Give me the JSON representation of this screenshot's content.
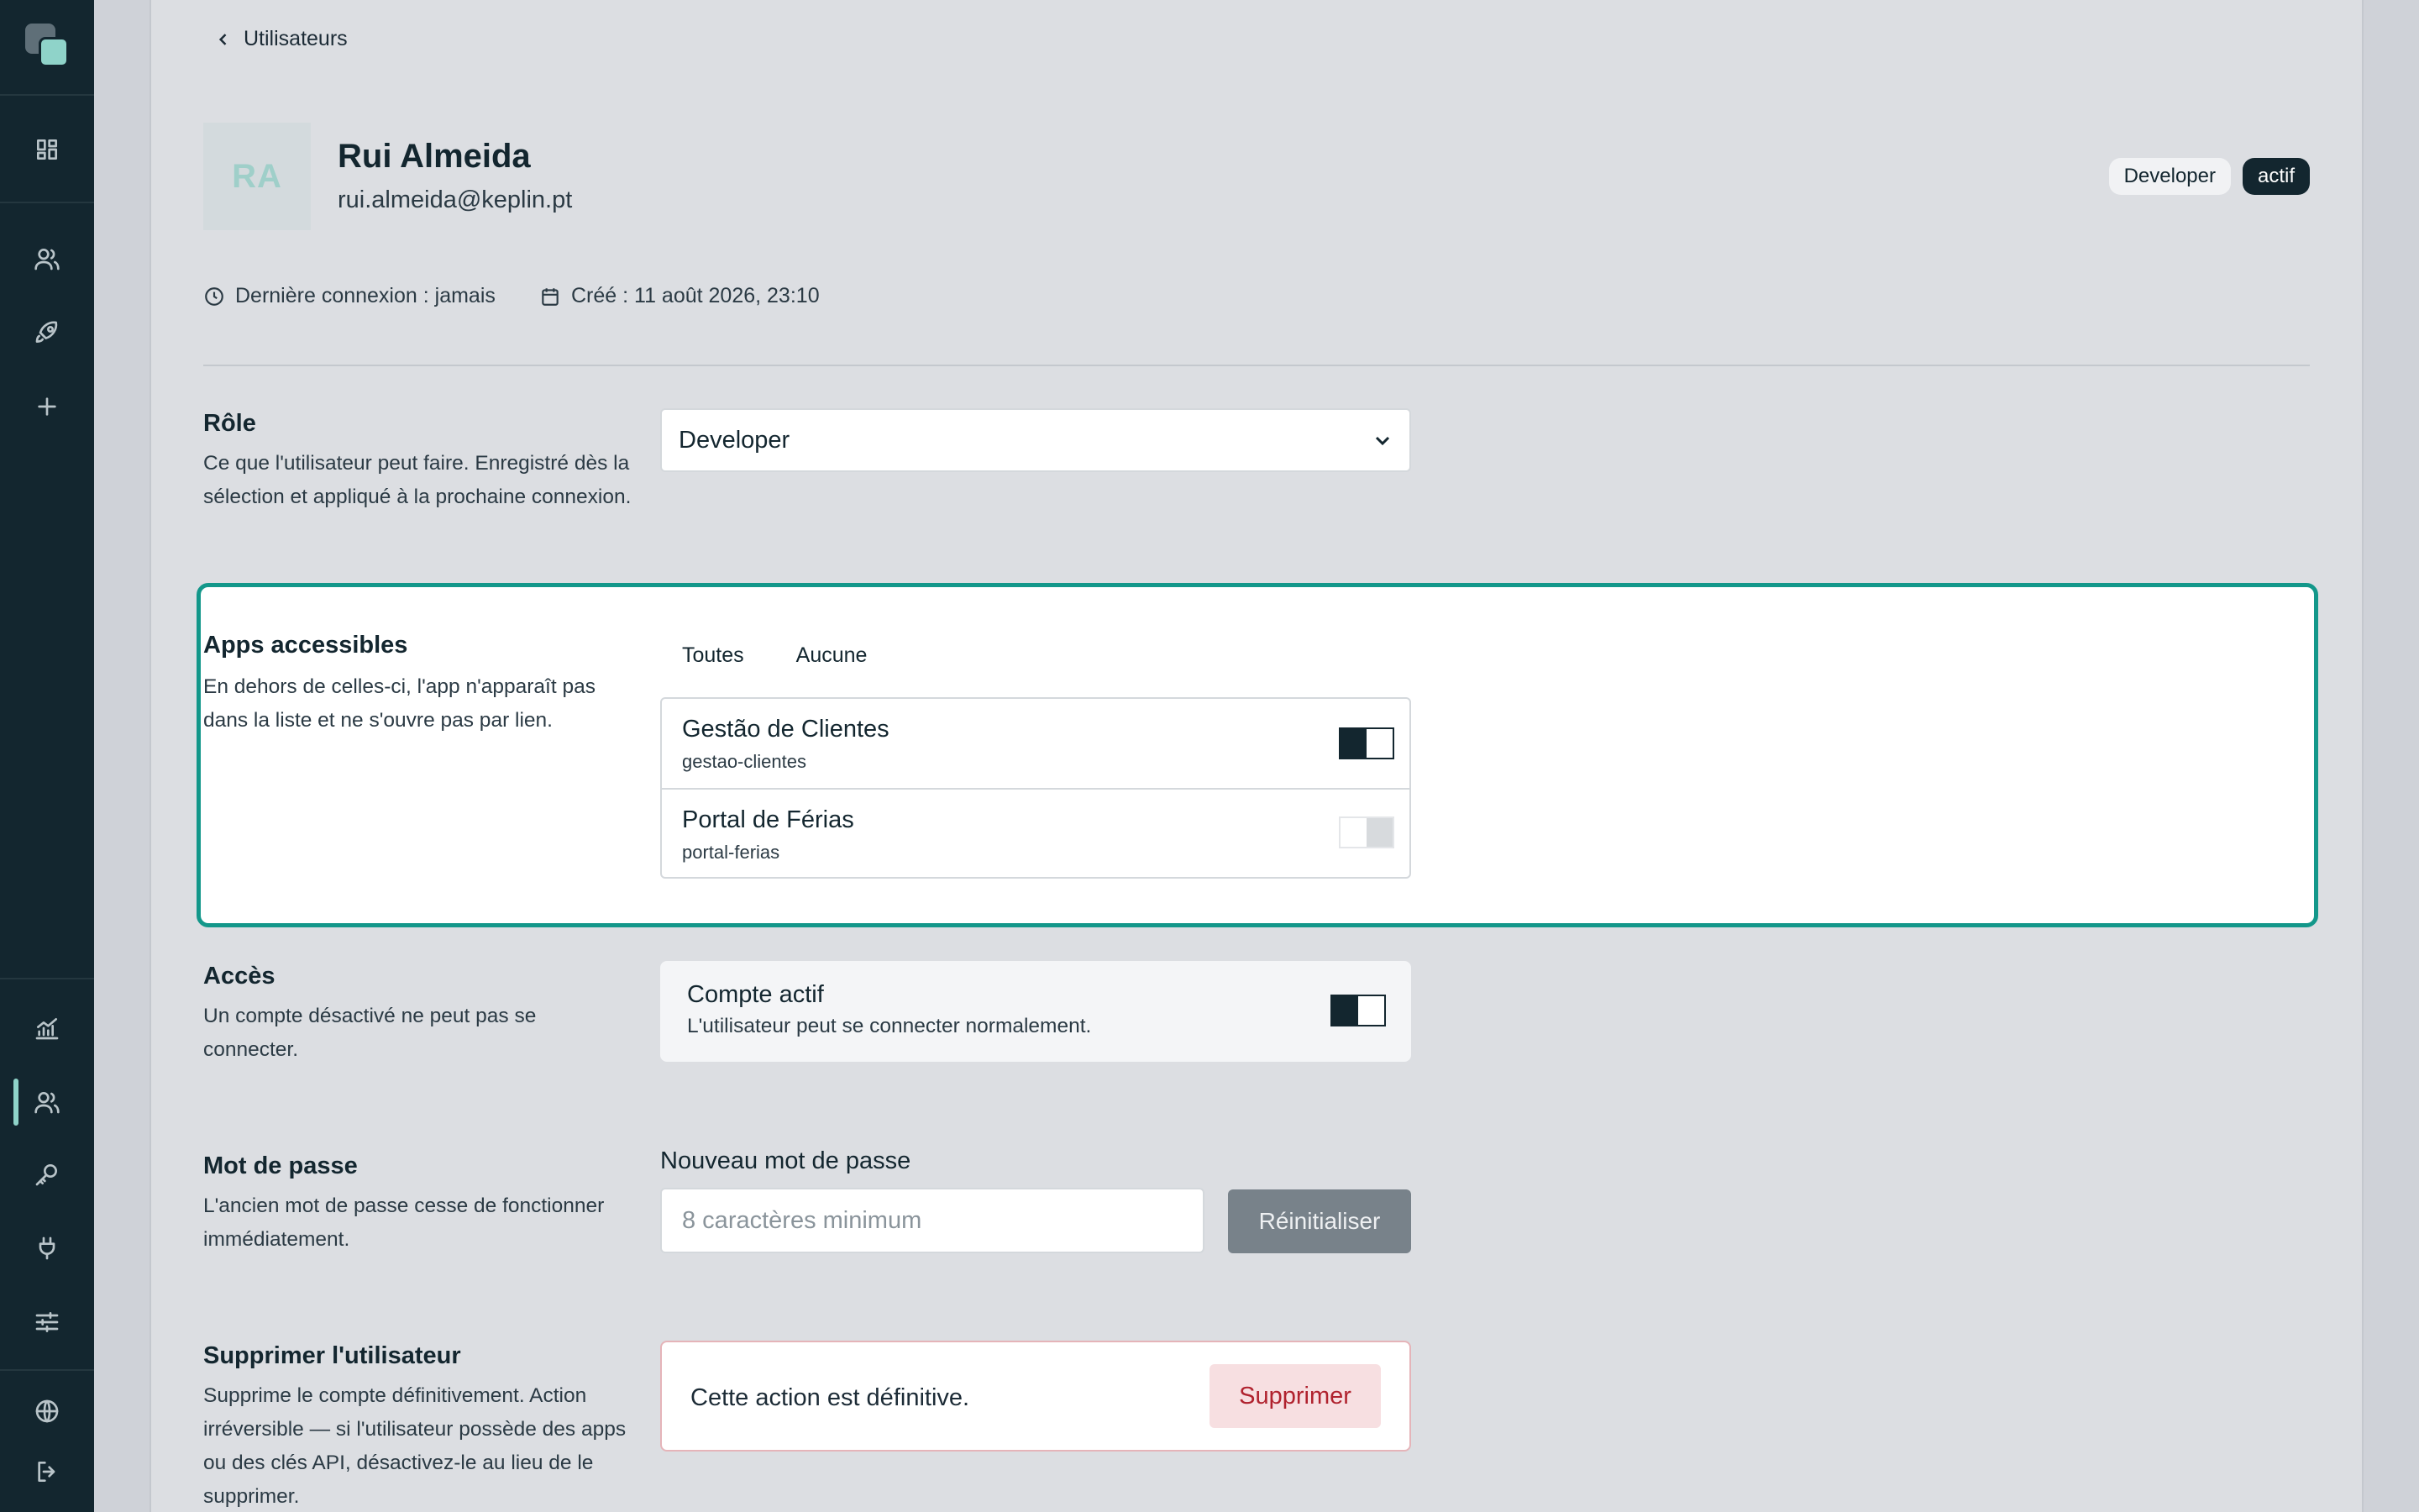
{
  "nav": {
    "back_label": "Utilisateurs"
  },
  "user": {
    "initials": "RA",
    "name": "Rui Almeida",
    "email": "rui.almeida@keplin.pt",
    "role_badge": "Developer",
    "status_badge": "actif",
    "last_login": "Dernière connexion : jamais",
    "created": "Créé : 11 août 2026, 23:10"
  },
  "role": {
    "title": "Rôle",
    "description": "Ce que l'utilisateur peut faire. Enregistré dès la sélection et appliqué à la prochaine connexion.",
    "selected": "Developer"
  },
  "apps": {
    "title": "Apps accessibles",
    "description": "En dehors de celles-ci, l'app n'apparaît pas dans la liste et ne s'ouvre pas par lien.",
    "all_label": "Toutes",
    "none_label": "Aucune",
    "items": [
      {
        "name": "Gestão de Clientes",
        "slug": "gestao-clientes",
        "enabled": true
      },
      {
        "name": "Portal de Férias",
        "slug": "portal-ferias",
        "enabled": false
      }
    ]
  },
  "access": {
    "title": "Accès",
    "description": "Un compte désactivé ne peut pas se connecter.",
    "card_title": "Compte actif",
    "card_subtitle": "L'utilisateur peut se connecter normalement.",
    "enabled": true
  },
  "password": {
    "title": "Mot de passe",
    "description": "L'ancien mot de passe cesse de fonctionner immédiatement.",
    "field_label": "Nouveau mot de passe",
    "placeholder": "8 caractères minimum",
    "button_label": "Réinitialiser"
  },
  "delete": {
    "title": "Supprimer l'utilisateur",
    "description": "Supprime le compte définitivement. Action irréversible — si l'utilisateur possède des apps ou des clés API, désactivez-le au lieu de le supprimer.",
    "warning": "Cette action est définitive.",
    "button_label": "Supprimer"
  },
  "sidebar": {
    "icons": [
      "logo",
      "dashboard-icon",
      "users-icon",
      "rocket-icon",
      "plus-icon",
      "chart-icon",
      "users-icon",
      "key-icon",
      "plug-icon",
      "sliders-icon",
      "globe-icon",
      "logout-icon"
    ]
  },
  "colors": {
    "sidebar_bg": "#13262f",
    "accent": "#13978a",
    "accent_light": "#8fd3c9",
    "danger": "#b0222e"
  }
}
